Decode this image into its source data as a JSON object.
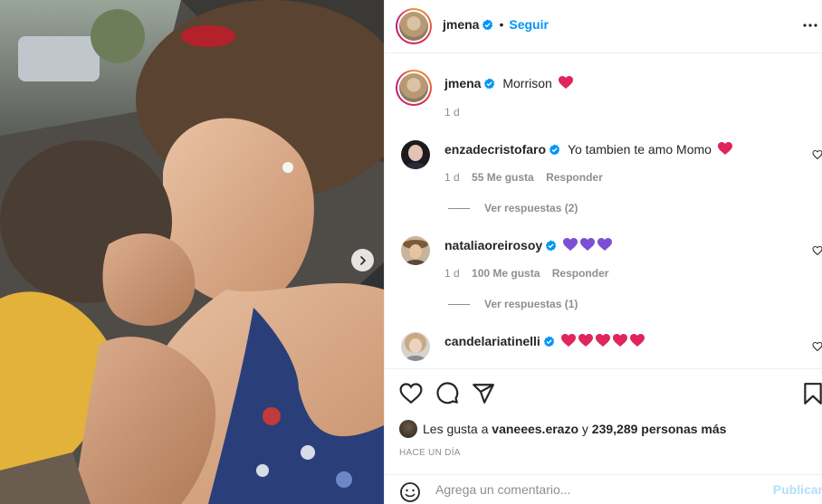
{
  "post": {
    "author": "jmena",
    "follow_label": "Seguir",
    "dot": "•",
    "caption_text": "Morrison",
    "caption_age": "1 d",
    "photo_alt": "post-photo"
  },
  "comments": [
    {
      "user": "enzadecristofaro",
      "text": "Yo tambien te amo Momo",
      "hearts": 1,
      "heart_color": "#e0245e",
      "age": "1 d",
      "likes": "55 Me gusta",
      "reply": "Responder",
      "view_replies": "Ver respuestas (2)"
    },
    {
      "user": "nataliaoreirosoy",
      "text": "",
      "hearts": 3,
      "heart_color": "#7b4fd6",
      "age": "1 d",
      "likes": "100 Me gusta",
      "reply": "Responder",
      "view_replies": "Ver respuestas (1)"
    },
    {
      "user": "candelariatinelli",
      "text": "",
      "hearts": 5,
      "heart_color": "#e0245e"
    }
  ],
  "likes_line": {
    "prefix": "Les gusta a",
    "user": "vaneees.erazo",
    "middle": "y",
    "count": "239,289 personas más"
  },
  "timestamp": "HACE UN DÍA",
  "comment_input": {
    "placeholder": "Agrega un comentario...",
    "publish": "Publicar"
  },
  "colors": {
    "link_blue": "#0095f6",
    "verified_blue": "#0095f6",
    "muted": "#8e8e8e",
    "publish_disabled": "#b2dffc"
  }
}
